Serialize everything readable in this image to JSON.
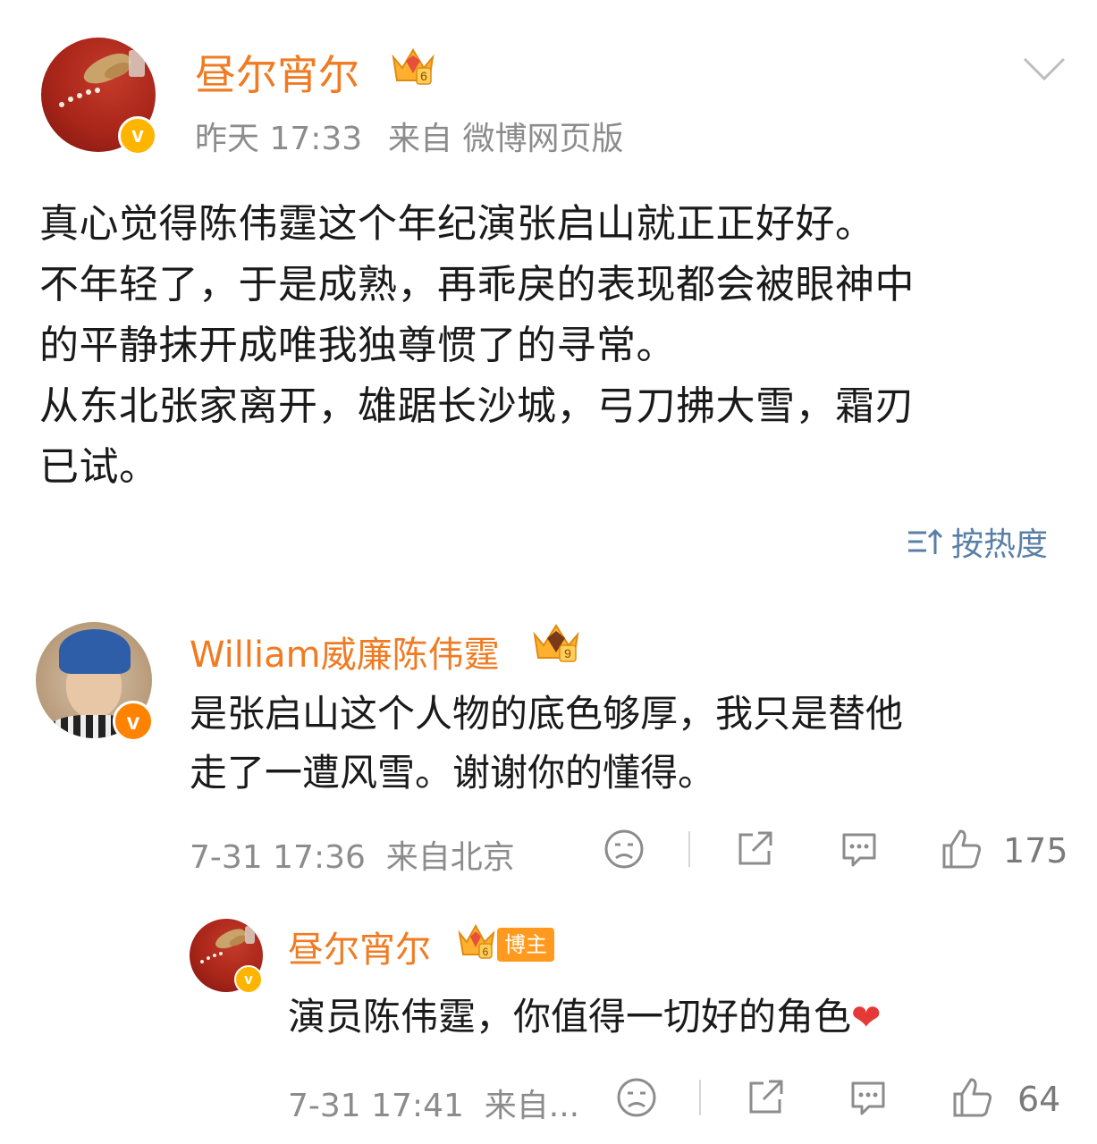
{
  "post": {
    "username": "昼尔宵尔",
    "level": "6",
    "time": "昨天 17:33",
    "source": "来自 微博网页版",
    "lines": [
      "真心觉得陈伟霆这个年纪演张启山就正正好好。",
      "不年轻了，于是成熟，再乖戾的表现都会被眼神中",
      "的平静抹开成唯我独尊惯了的寻常。",
      "从东北张家离开，雄踞长沙城，弓刀拂大雪，霜刃",
      "已试。"
    ]
  },
  "sort_label": "按热度",
  "comments": [
    {
      "username": "William威廉陈伟霆",
      "level": "9",
      "text_lines": [
        "是张启山这个人物的底色够厚，我只是替他",
        "走了一遭风雪。谢谢你的懂得。"
      ],
      "meta": "7-31 17:36  来自北京",
      "likes": "175"
    }
  ],
  "reply": {
    "username": "昼尔宵尔",
    "level": "6",
    "badge": "博主",
    "text": "演员陈伟霆，你值得一切好的角色",
    "emoji": "❤",
    "meta": "7-31 17:41  来自...",
    "likes": "64"
  },
  "colors": {
    "username": "#f07b22",
    "meta": "#8c8c8c",
    "link": "#5a7fa6",
    "verified_gold": "#ffb400",
    "verified_orange": "#ff8200",
    "heart": "#e53935"
  },
  "icons": [
    "chevron-down-icon",
    "crown-icon",
    "sort-icon",
    "sad-face-icon",
    "share-icon",
    "comment-icon",
    "like-icon",
    "heart-emoji-icon"
  ]
}
